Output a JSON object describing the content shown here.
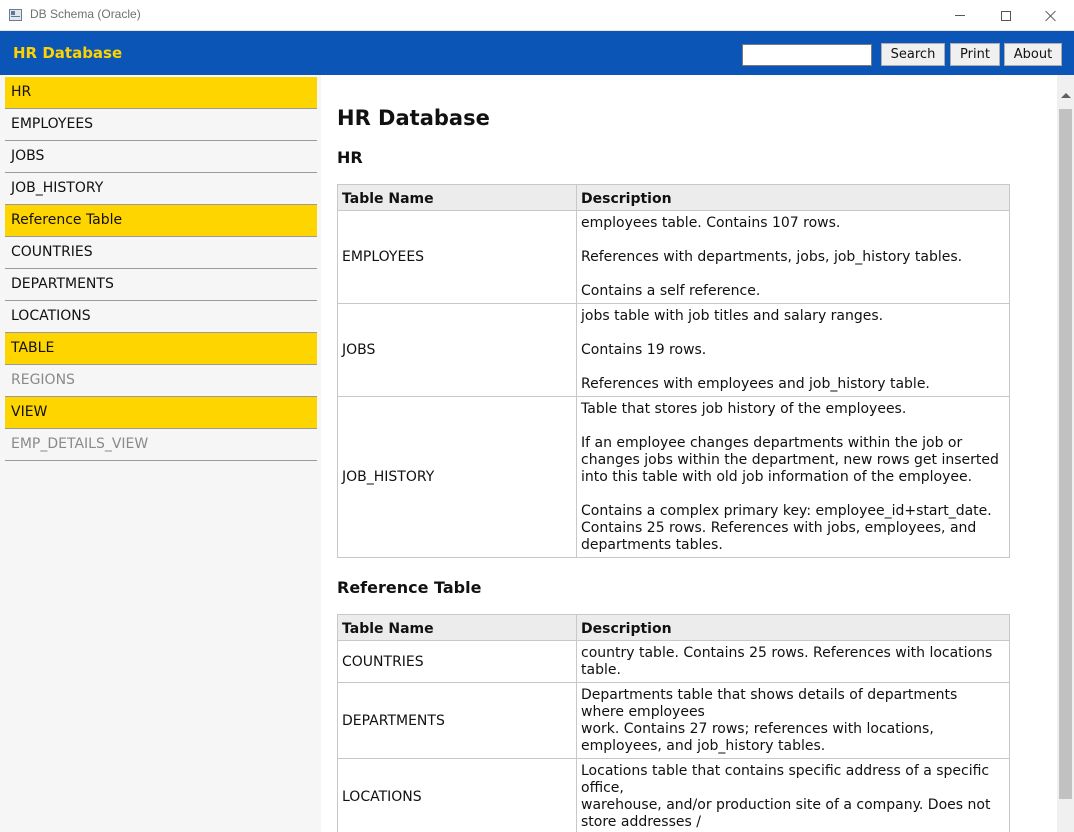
{
  "window": {
    "title": "DB Schema (Oracle)"
  },
  "header": {
    "title": "HR Database",
    "search_placeholder": "",
    "search_label": "Search",
    "print_label": "Print",
    "about_label": "About"
  },
  "sidebar": {
    "items": [
      {
        "label": "HR",
        "type": "section"
      },
      {
        "label": "EMPLOYEES",
        "type": "item"
      },
      {
        "label": "JOBS",
        "type": "item"
      },
      {
        "label": "JOB_HISTORY",
        "type": "item"
      },
      {
        "label": "Reference Table",
        "type": "section"
      },
      {
        "label": "COUNTRIES",
        "type": "item"
      },
      {
        "label": "DEPARTMENTS",
        "type": "item"
      },
      {
        "label": "LOCATIONS",
        "type": "item"
      },
      {
        "label": "TABLE",
        "type": "section"
      },
      {
        "label": "REGIONS",
        "type": "dim"
      },
      {
        "label": "VIEW",
        "type": "section"
      },
      {
        "label": "EMP_DETAILS_VIEW",
        "type": "dim"
      }
    ]
  },
  "content": {
    "page_title": "HR Database",
    "columns": {
      "name": "Table Name",
      "description": "Description"
    },
    "sections": [
      {
        "title": "HR",
        "rows": [
          {
            "name": "EMPLOYEES",
            "paragraphs": [
              "employees table. Contains 107 rows.",
              "References with departments, jobs, job_history tables.",
              "Contains a self reference."
            ]
          },
          {
            "name": "JOBS",
            "paragraphs": [
              "jobs table with job titles and salary ranges.",
              "Contains 19 rows.",
              "References with employees and job_history table."
            ]
          },
          {
            "name": "JOB_HISTORY",
            "paragraphs": [
              "Table that stores job history of the employees.",
              "If an employee changes departments within the job or\nchanges jobs within the department, new rows get inserted\ninto this table with old job information of the employee.",
              "Contains a complex primary key: employee_id+start_date.\nContains 25 rows. References with jobs, employees, and\ndepartments tables."
            ]
          }
        ]
      },
      {
        "title": "Reference Table",
        "rows": [
          {
            "name": "COUNTRIES",
            "paragraphs": [
              "country table. Contains 25 rows. References with locations\ntable."
            ]
          },
          {
            "name": "DEPARTMENTS",
            "paragraphs": [
              "Departments table that shows details of departments\nwhere employees\nwork. Contains 27 rows; references with locations,\nemployees, and job_history tables."
            ]
          },
          {
            "name": "LOCATIONS",
            "paragraphs": [
              "Locations table that contains specific address of a specific\noffice,\nwarehouse, and/or production site of a company. Does not\nstore addresses /"
            ]
          }
        ]
      }
    ]
  }
}
